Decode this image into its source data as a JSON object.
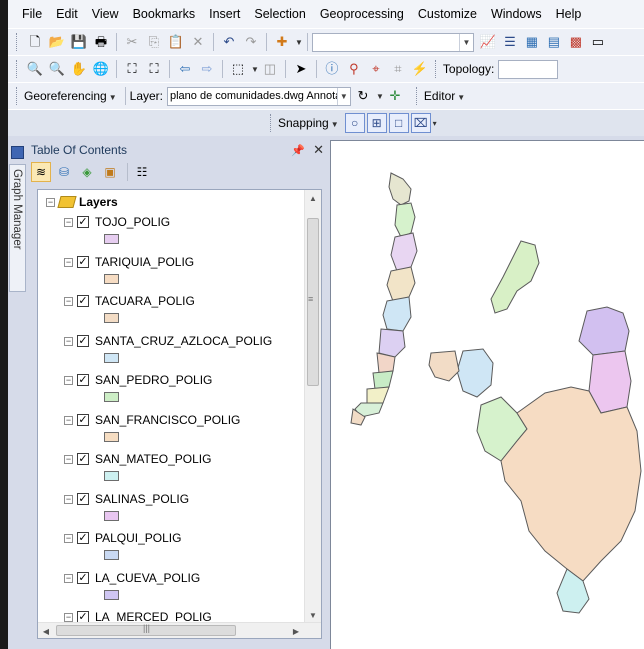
{
  "menu": [
    "File",
    "Edit",
    "View",
    "Bookmarks",
    "Insert",
    "Selection",
    "Geoprocessing",
    "Customize",
    "Windows",
    "Help"
  ],
  "toolbar": {
    "topology_label": "Topology:",
    "georef_label": "Georeferencing",
    "layer_label": "Layer:",
    "layer_value": "plano de comunidades.dwg Annotati",
    "editor_label": "Editor",
    "snapping_label": "Snapping"
  },
  "sidetab": {
    "label": "Graph Manager"
  },
  "toc": {
    "title": "Table Of Contents",
    "root_label": "Layers",
    "layers": [
      {
        "name": "TOJO_POLIG",
        "color": "#e6cdf0"
      },
      {
        "name": "TARIQUIA_POLIG",
        "color": "#f6dcc3"
      },
      {
        "name": "TACUARA_POLIG",
        "color": "#f3dcc5"
      },
      {
        "name": "SANTA_CRUZ_AZLOCA_POLIG",
        "color": "#cfe6f5"
      },
      {
        "name": "SAN_PEDRO_POLIG",
        "color": "#cdeec6"
      },
      {
        "name": "SAN_FRANCISCO_POLIG",
        "color": "#f6ddc2"
      },
      {
        "name": "SAN_MATEO_POLIG",
        "color": "#cdf0f0"
      },
      {
        "name": "SALINAS_POLIG",
        "color": "#e8c6f0"
      },
      {
        "name": "PALQUI_POLIG",
        "color": "#c9d9f2"
      },
      {
        "name": "LA_CUEVA_POLIG",
        "color": "#cfc6f2"
      },
      {
        "name": "LA_MERCED_POLIG",
        "color": "#e6e6e6"
      }
    ]
  }
}
